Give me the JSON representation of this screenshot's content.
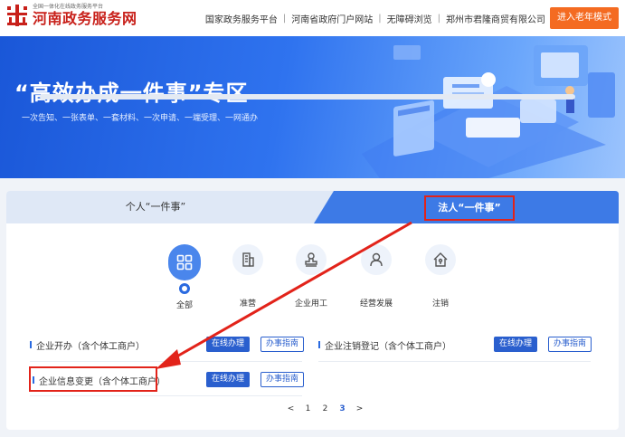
{
  "header": {
    "logo_small": "全国一体化在线政务服务平台",
    "logo_main": "河南政务服务网",
    "nav": [
      "国家政务服务平台",
      "河南省政府门户网站",
      "无障碍浏览",
      "郑州市君隆商贸有限公司"
    ],
    "elder_mode": "进入老年模式"
  },
  "banner": {
    "title": "“高效办成一件事”专区",
    "subtitle": "一次告知、一张表单、一套材料、一次申请、一端受理、一网通办"
  },
  "tabs": {
    "personal": "个人“一件事”",
    "corporate": "法人“一件事”"
  },
  "categories": [
    {
      "label": "全部",
      "icon": "grid-icon"
    },
    {
      "label": "准营",
      "icon": "building-icon"
    },
    {
      "label": "企业用工",
      "icon": "stamp-icon"
    },
    {
      "label": "经营发展",
      "icon": "person-icon"
    },
    {
      "label": "注销",
      "icon": "house-icon"
    }
  ],
  "items": [
    {
      "name": "企业开办（含个体工商户）",
      "online": "在线办理",
      "guide": "办事指南"
    },
    {
      "name": "企业注销登记（含个体工商户）",
      "online": "在线办理",
      "guide": "办事指南"
    },
    {
      "name": "企业信息变更（含个体工商户）",
      "online": "在线办理",
      "guide": "办事指南"
    }
  ],
  "pager": {
    "prev": "<",
    "pages": [
      "1",
      "2",
      "3"
    ],
    "current": "3",
    "next": ">"
  },
  "colors": {
    "brand_red": "#c8201a",
    "primary_blue": "#2a5fce",
    "elder_orange": "#f46b21",
    "highlight_red": "#e2231a"
  }
}
